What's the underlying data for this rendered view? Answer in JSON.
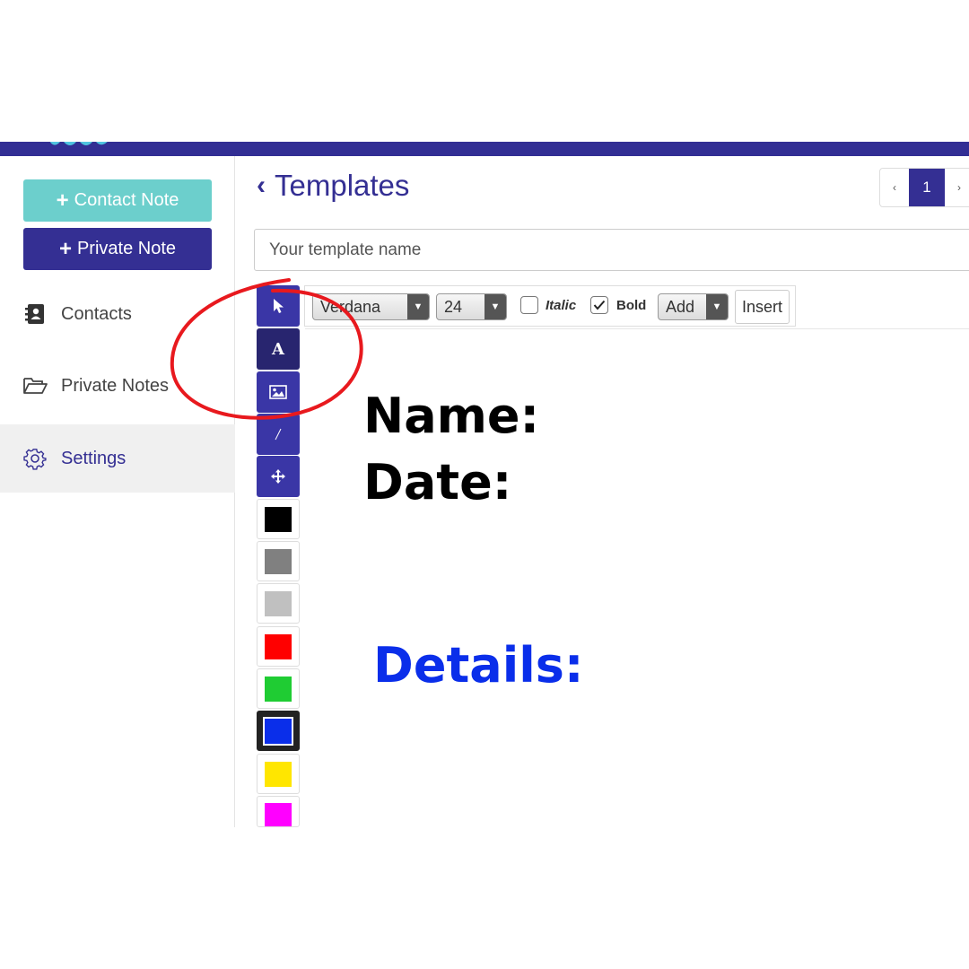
{
  "sidebar": {
    "contact_note_label": "Contact Note",
    "private_note_label": "Private Note",
    "items": [
      {
        "label": "Contacts",
        "icon": "address-book-icon"
      },
      {
        "label": "Private Notes",
        "icon": "folder-open-icon"
      },
      {
        "label": "Settings",
        "icon": "gear-icon",
        "active": true
      }
    ]
  },
  "header": {
    "title": "Templates",
    "pagination": {
      "prev": "‹",
      "current": "1",
      "next": "›"
    }
  },
  "template_name": {
    "placeholder": "Your template name"
  },
  "toolbar": {
    "font": "Verdana",
    "size": "24",
    "italic_label": "Italic",
    "italic_checked": false,
    "bold_label": "Bold",
    "bold_checked": true,
    "add_label": "Add",
    "insert_label": "Insert"
  },
  "tools": [
    "pointer-icon",
    "text-icon",
    "image-icon",
    "line-icon",
    "move-icon"
  ],
  "palette": [
    "#000000",
    "#808080",
    "#c0c0c0",
    "#ff0000",
    "#1fcc33",
    "#0a2eea",
    "#ffe600",
    "#ff00ff"
  ],
  "canvas": {
    "lines": [
      "Name:",
      "Date:",
      "Details:"
    ],
    "colors": {
      "label": "#000000",
      "details": "#0a2eea"
    }
  },
  "colors": {
    "brand": "#342f93",
    "teal": "#6ccfcc",
    "annotation": "#e8191e"
  }
}
